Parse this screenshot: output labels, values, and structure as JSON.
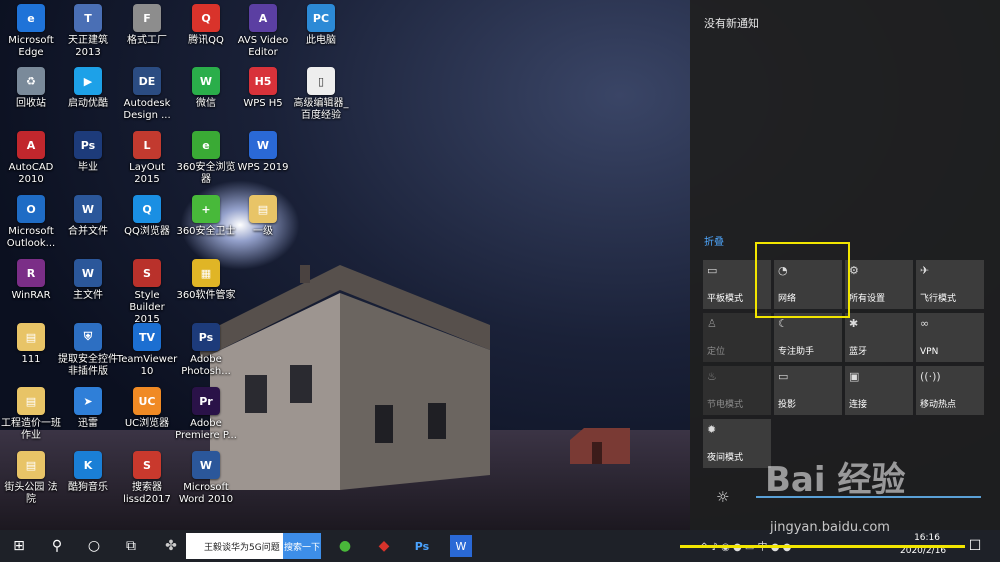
{
  "desktop_icons": [
    {
      "label": "Microsoft Edge",
      "color": "#1f73d8",
      "glyph": "e"
    },
    {
      "label": "天正建筑 2013",
      "color": "#4a6fb5",
      "glyph": "T"
    },
    {
      "label": "格式工厂",
      "color": "#8d8d8d",
      "glyph": "F"
    },
    {
      "label": "腾讯QQ",
      "color": "#d9332b",
      "glyph": "Q"
    },
    {
      "label": "AVS Video Editor",
      "color": "#5b3fa2",
      "glyph": "A"
    },
    {
      "label": "此电脑",
      "color": "#2c8ad6",
      "glyph": "PC"
    },
    {
      "label": "回收站",
      "color": "#7a8a9a",
      "glyph": "♻"
    },
    {
      "label": "启动优酷",
      "color": "#1da1e8",
      "glyph": "▶"
    },
    {
      "label": "Autodesk Design ...",
      "color": "#2b4c82",
      "glyph": "DE"
    },
    {
      "label": "微信",
      "color": "#2aae4a",
      "glyph": "W"
    },
    {
      "label": "WPS H5",
      "color": "#d8323a",
      "glyph": "H5"
    },
    {
      "label": "高级编辑器_百度经验",
      "color": "#eeeeee",
      "glyph": "▯"
    },
    {
      "label": "AutoCAD 2010",
      "color": "#c1272d",
      "glyph": "A"
    },
    {
      "label": "毕业",
      "color": "#1d3b7a",
      "glyph": "Ps"
    },
    {
      "label": "LayOut 2015",
      "color": "#c23a2f",
      "glyph": "L"
    },
    {
      "label": "360安全浏览器",
      "color": "#3aaa35",
      "glyph": "e"
    },
    {
      "label": "WPS 2019",
      "color": "#2a69d6",
      "glyph": "W"
    },
    {
      "label": "Microsoft Outlook...",
      "color": "#1f6cc5",
      "glyph": "O"
    },
    {
      "label": "合并文件",
      "color": "#2b579a",
      "glyph": "W"
    },
    {
      "label": "QQ浏览器",
      "color": "#1a8fe3",
      "glyph": "Q"
    },
    {
      "label": "360安全卫士",
      "color": "#48b93a",
      "glyph": "+"
    },
    {
      "label": "一级",
      "color": "#e8c467",
      "glyph": "▤"
    },
    {
      "label": "WinRAR",
      "color": "#7b2e87",
      "glyph": "R"
    },
    {
      "label": "主文件",
      "color": "#2b579a",
      "glyph": "W"
    },
    {
      "label": "Style Builder 2015",
      "color": "#b9312b",
      "glyph": "S"
    },
    {
      "label": "360软件管家",
      "color": "#e0b526",
      "glyph": "▦"
    },
    {
      "label": "111",
      "color": "#e8c467",
      "glyph": "▤"
    },
    {
      "label": "提取安全控件非插件版",
      "color": "#2d6fc2",
      "glyph": "⛨"
    },
    {
      "label": "TeamViewer 10",
      "color": "#1c6fd1",
      "glyph": "TV"
    },
    {
      "label": "Adobe Photosh...",
      "color": "#1d3b7a",
      "glyph": "Ps"
    },
    {
      "label": "工程造价一班作业",
      "color": "#e8c467",
      "glyph": "▤"
    },
    {
      "label": "迅雷",
      "color": "#2f7fd8",
      "glyph": "➤"
    },
    {
      "label": "UC浏览器",
      "color": "#f08a24",
      "glyph": "UC"
    },
    {
      "label": "Adobe Premiere P...",
      "color": "#2a1248",
      "glyph": "Pr"
    },
    {
      "label": "街头公园 法院",
      "color": "#e8c467",
      "glyph": "▤"
    },
    {
      "label": "酷狗音乐",
      "color": "#1a7fd6",
      "glyph": "K"
    },
    {
      "label": "搜索器 lissd2017",
      "color": "#c9392d",
      "glyph": "S"
    },
    {
      "label": "Microsoft Word 2010",
      "color": "#2b579a",
      "glyph": "W"
    }
  ],
  "action_center": {
    "no_notifications": "没有新通知",
    "collapse": "折叠",
    "tiles": [
      {
        "label": "平板模式",
        "icon": "▭",
        "active": true
      },
      {
        "label": "网络",
        "icon": "◔",
        "active": true
      },
      {
        "label": "所有设置",
        "icon": "⚙",
        "active": true
      },
      {
        "label": "飞行模式",
        "icon": "✈",
        "active": true
      },
      {
        "label": "定位",
        "icon": "♙",
        "active": false
      },
      {
        "label": "专注助手",
        "icon": "☾",
        "active": true
      },
      {
        "label": "蓝牙",
        "icon": "✱",
        "active": true
      },
      {
        "label": "VPN",
        "icon": "∞",
        "active": true
      },
      {
        "label": "节电模式",
        "icon": "♨",
        "active": false
      },
      {
        "label": "投影",
        "icon": "▭",
        "active": true
      },
      {
        "label": "连接",
        "icon": "▣",
        "active": true
      },
      {
        "label": "移动热点",
        "icon": "((·))",
        "active": true
      },
      {
        "label": "夜间模式",
        "icon": "✹",
        "active": true
      }
    ],
    "brightness_icon": "☼"
  },
  "taskbar": {
    "start_icon": "⊞",
    "search_icon": "⚲",
    "cortana_icon": "○",
    "taskview_icon": "⧉",
    "search_text": "王毅谈华为5G问题",
    "search_button": "搜索一下",
    "tray_text": "^ ♪ ◉ ● ▭ 中 ● ●",
    "time": "16:16",
    "date": "2020/2/16",
    "notify_icon": "☐"
  },
  "watermark": {
    "main": "Bai 经验",
    "sub": "jingyan.baidu.com"
  }
}
